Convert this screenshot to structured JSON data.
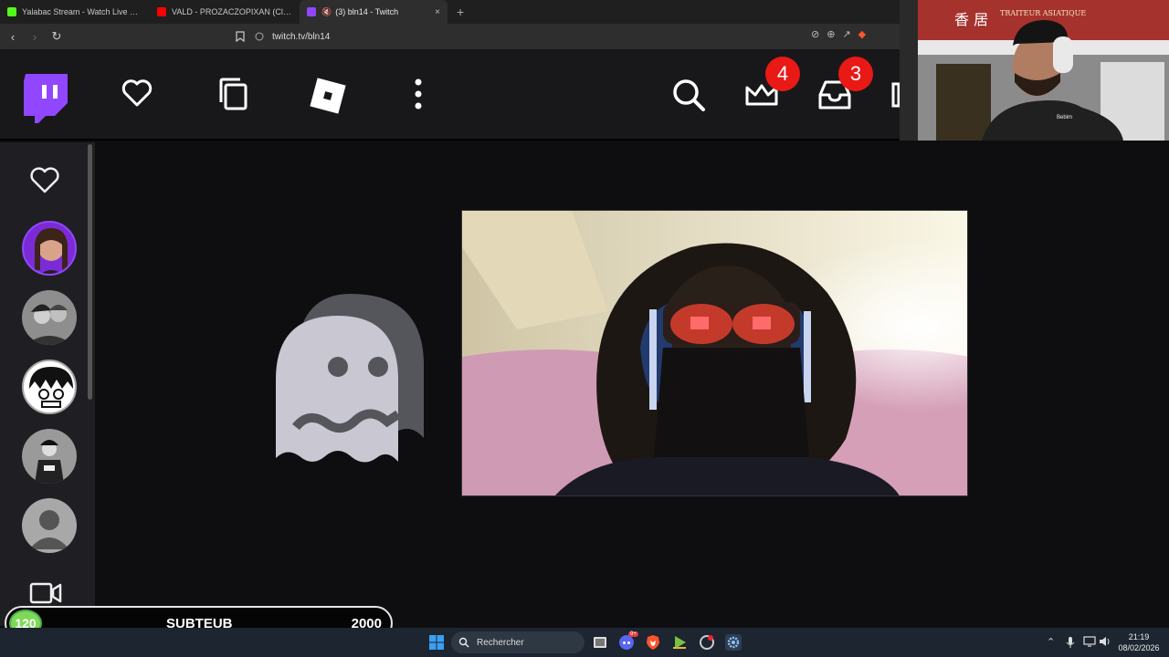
{
  "browser": {
    "tabs": [
      {
        "title": "Yalabac Stream - Watch Live on Kick",
        "favicon_color": "#53fc18"
      },
      {
        "title": "VALD - PROZACZOPIXAN (Clip officiel)",
        "favicon_color": "#ff0000"
      },
      {
        "title": "(3) bln14 - Twitch",
        "favicon_color": "#9146ff",
        "active": true
      }
    ],
    "new_tab": "+",
    "close_glyph": "×",
    "url": "twitch.tv/bln14"
  },
  "topnav": {
    "notifications_badge": "4",
    "inbox_badge": "3"
  },
  "webcam_sign": {
    "chinese": "香 居",
    "line1": "TRAITEUR ASIATIQUE",
    "shirt_text": "Bebim"
  },
  "subgoal": {
    "count": "120",
    "label": "SUBTEUB",
    "goal": "2000"
  },
  "taskbar": {
    "search_placeholder": "Rechercher",
    "discord_badge": "9+",
    "time": "21:19",
    "date": "08/02/2026"
  },
  "colors": {
    "twitch_purple": "#9146ff",
    "badge_red": "#e91916",
    "goal_green": "#7ed957"
  }
}
